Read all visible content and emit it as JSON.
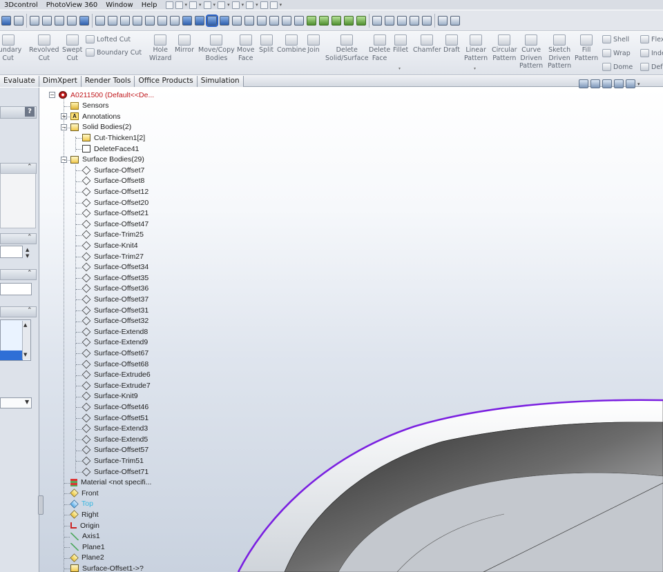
{
  "menu": {
    "items": [
      "3Dcontrol",
      "PhotoView 360",
      "Window",
      "Help"
    ]
  },
  "ribbon": {
    "boundary_cut": "oundary\nCut",
    "revolved_cut": "Revolved\nCut",
    "swept_cut": "Swept\nCut",
    "lofted_cut": "Lofted Cut",
    "boundary_cut2": "Boundary Cut",
    "hole_wizard": "Hole\nWizard",
    "mirror": "Mirror",
    "move_copy": "Move/Copy\nBodies",
    "move_face": "Move\nFace",
    "split": "Split",
    "combine": "Combine",
    "join": "Join",
    "delete_solid": "Delete\nSolid/Surface",
    "delete_face": "Delete\nFace",
    "fillet": "Fillet",
    "chamfer": "Chamfer",
    "draft": "Draft",
    "linear_pattern": "Linear\nPattern",
    "circular_pattern": "Circular\nPattern",
    "curve_driven": "Curve\nDriven\nPattern",
    "sketch_driven": "Sketch\nDriven\nPattern",
    "fill_pattern": "Fill\nPattern",
    "shell": "Shell",
    "wrap": "Wrap",
    "dome": "Dome",
    "flex": "Flex",
    "indent": "Inde",
    "deform": "Def"
  },
  "tabs": [
    "Evaluate",
    "DimXpert",
    "Render Tools",
    "Office Products",
    "Simulation"
  ],
  "panel": {
    "help": "?"
  },
  "tree": {
    "root": "A0211500  (Default<<De...",
    "sensors": "Sensors",
    "annotations": "Annotations",
    "solid_bodies": "Solid Bodies(2)",
    "solid_items": [
      "Cut-Thicken1[2]",
      "DeleteFace41"
    ],
    "surface_bodies": "Surface Bodies(29)",
    "surface_items": [
      "Surface-Offset7",
      "Surface-Offset8",
      "Surface-Offset12",
      "Surface-Offset20",
      "Surface-Offset21",
      "Surface-Offset47",
      "Surface-Trim25",
      "Surface-Knit4",
      "Surface-Trim27",
      "Surface-Offset34",
      "Surface-Offset35",
      "Surface-Offset36",
      "Surface-Offset37",
      "Surface-Offset31",
      "Surface-Offset32",
      "Surface-Extend8",
      "Surface-Extend9",
      "Surface-Offset67",
      "Surface-Offset68",
      "Surface-Extrude6",
      "Surface-Extrude7",
      "Surface-Knit9",
      "Surface-Offset46",
      "Surface-Offset51",
      "Surface-Extend3",
      "Surface-Extend5",
      "Surface-Offset57",
      "Surface-Trim51",
      "Surface-Offset71"
    ],
    "material": "Material <not specifi...",
    "front": "Front",
    "top": "Top",
    "right": "Right",
    "origin": "Origin",
    "axis1": "Axis1",
    "plane1": "Plane1",
    "plane2": "Plane2",
    "last": "Surface-Offset1->?"
  },
  "colors": {
    "selection_edge": "#7a1fe0",
    "part_name": "#c0161a",
    "highlight": "#38b7e0"
  }
}
